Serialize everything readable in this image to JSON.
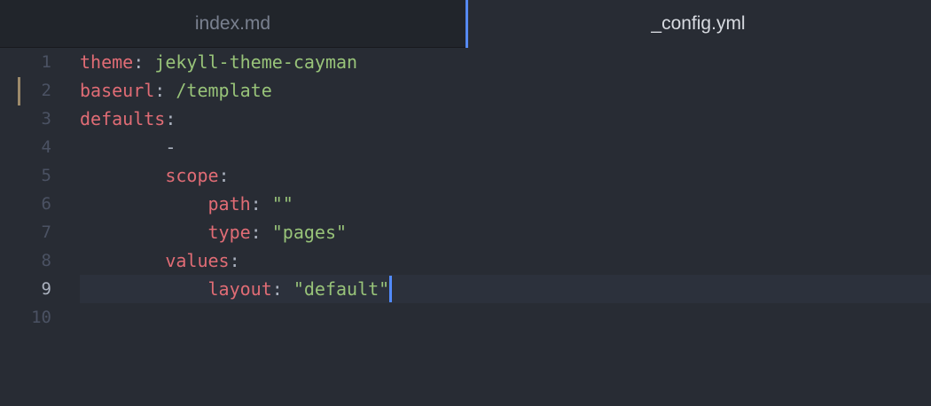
{
  "tabs": [
    {
      "label": "index.md",
      "active": false
    },
    {
      "label": "_config.yml",
      "active": true
    }
  ],
  "editor": {
    "cursor_line": 9,
    "modified_line": 2,
    "lines": [
      {
        "number": "1",
        "indent": "",
        "key": "theme",
        "sep": ": ",
        "value": "jekyll-theme-cayman"
      },
      {
        "number": "2",
        "indent": "",
        "key": "baseurl",
        "sep": ": ",
        "value": "/template"
      },
      {
        "number": "3",
        "indent": "",
        "key": "defaults",
        "sep": ":",
        "value": ""
      },
      {
        "number": "4",
        "indent": "        ",
        "key": "",
        "sep": "",
        "value": "",
        "plain": "-"
      },
      {
        "number": "5",
        "indent": "        ",
        "key": "scope",
        "sep": ":",
        "value": ""
      },
      {
        "number": "6",
        "indent": "            ",
        "key": "path",
        "sep": ": ",
        "value": "\"\""
      },
      {
        "number": "7",
        "indent": "            ",
        "key": "type",
        "sep": ": ",
        "value": "\"pages\""
      },
      {
        "number": "8",
        "indent": "        ",
        "key": "values",
        "sep": ":",
        "value": ""
      },
      {
        "number": "9",
        "indent": "            ",
        "key": "layout",
        "sep": ": ",
        "value": "\"default\""
      },
      {
        "number": "10",
        "indent": "",
        "key": "",
        "sep": "",
        "value": ""
      }
    ]
  },
  "colors": {
    "background": "#282c34",
    "tab_bar": "#21252b",
    "accent": "#568af2",
    "key": "#e06c75",
    "string": "#98c379",
    "line_number": "#4b5263"
  }
}
